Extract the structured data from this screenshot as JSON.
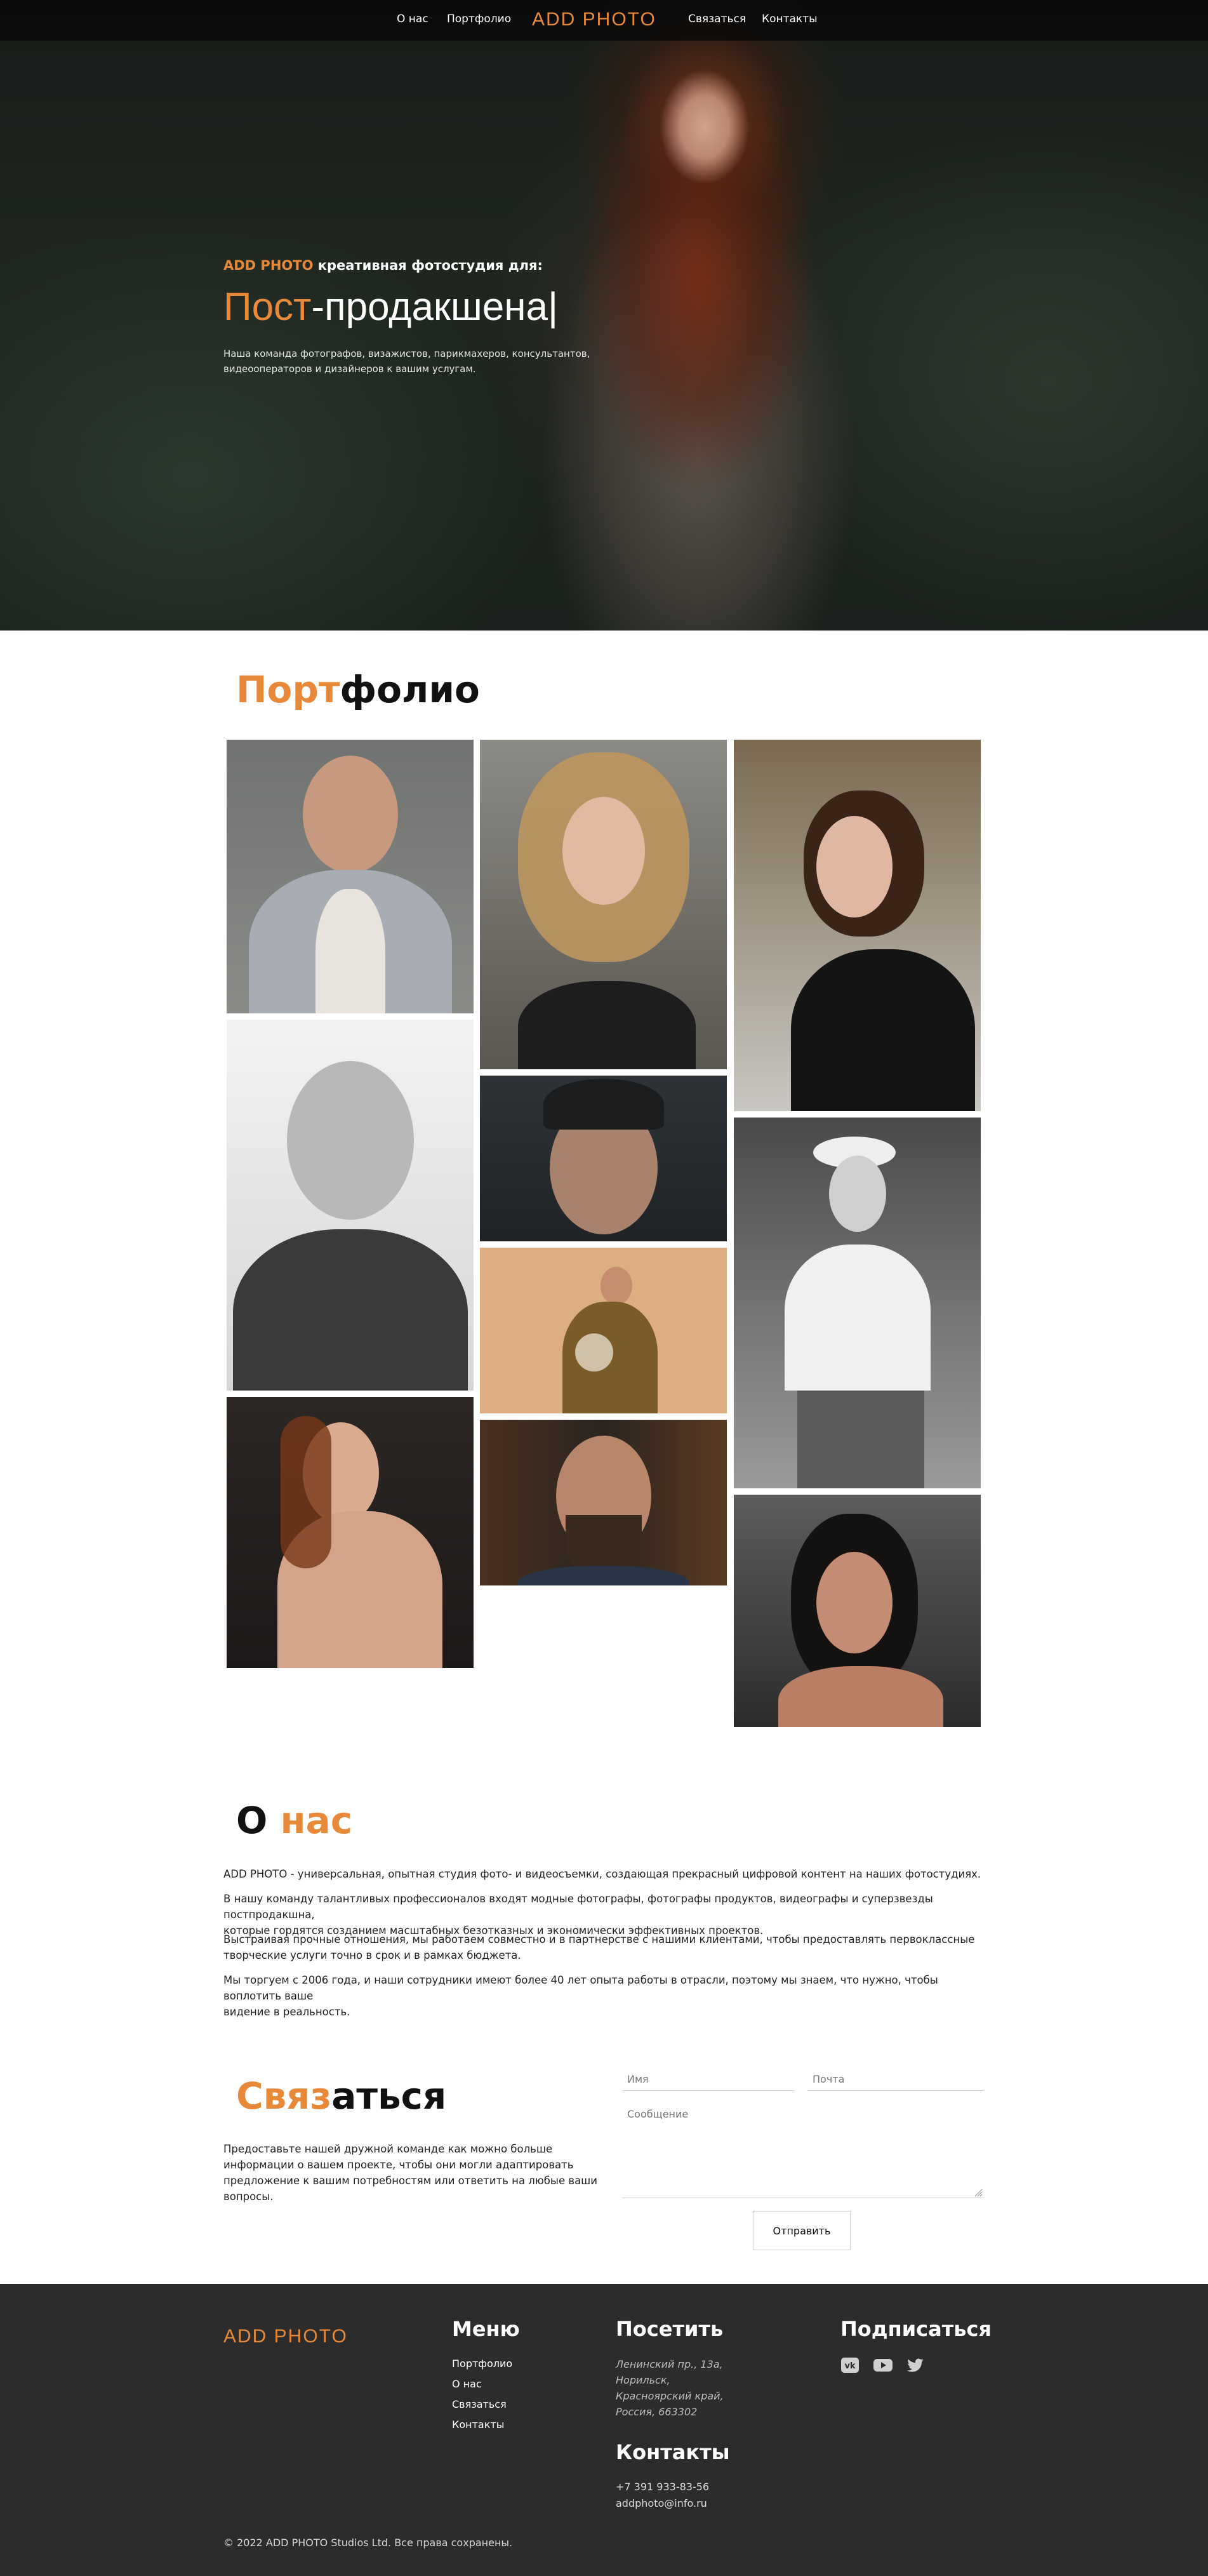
{
  "nav": {
    "about": "О нас",
    "portfolio": "Портфолио",
    "logo": "ADD PHOTO",
    "contact": "Связаться",
    "contacts": "Контакты"
  },
  "hero": {
    "sub_accent": "ADD PHOTO",
    "sub_rest": " креативная фотостудия для:",
    "title_accent": "Пост",
    "title_rest": "-продакшена|",
    "desc_line1": "Наша команда фотографов, визажистов, парикмахеров, консультантов,",
    "desc_line2": "видеооператоров и дизайнеров к вашим услугам."
  },
  "portfolio": {
    "title_accent": "Порт",
    "title_rest": "фолио"
  },
  "about": {
    "title_first": "О ",
    "title_accent": "нас",
    "p1": "ADD PHOTO - универсальная, опытная студия фото- и видеосъемки, создающая прекрасный цифровой контент на наших фотостудиях.",
    "p2_line1": "В нашу команду талантливых профессионалов входят модные фотографы, фотографы продуктов, видеографы и суперзвезды постпродакшна,",
    "p2_line2": "которые гордятся созданием масштабных безотказных и экономически эффективных проектов.",
    "p3_line1": "Выстраивая прочные отношения, мы работаем совместно и в партнерстве с нашими клиентами, чтобы предоставлять первоклассные",
    "p3_line2": "творческие услуги точно в срок и в рамках бюджета.",
    "p4_line1": "Мы торгуем с 2006 года, и наши сотрудники имеют более 40 лет опыта работы в отрасли, поэтому мы знаем, что нужно, чтобы воплотить ваше",
    "p4_line2": "видение в реальность."
  },
  "contact": {
    "title_accent": "Связ",
    "title_rest": "аться",
    "desc_line1": "Предоставьте нашей дружной команде как можно больше",
    "desc_line2": "информации о вашем проекте, чтобы они могли адаптировать",
    "desc_line3": "предложение к вашим потребностям или ответить на любые ваши",
    "desc_line4": "вопросы.",
    "name_placeholder": "Имя",
    "email_placeholder": "Почта",
    "message_placeholder": "Сообщение",
    "send": "Отправить"
  },
  "footer": {
    "logo": "ADD PHOTO",
    "menu_title": "Меню",
    "menu": [
      "Портфолио",
      "О нас",
      "Связаться",
      "Контакты"
    ],
    "visit_title": "Посетить",
    "address": [
      "Ленинский пр., 13а,",
      "Норильск,",
      "Красноярский край,",
      "Россия, 663302"
    ],
    "contacts_title": "Контакты",
    "phone": "+7 391 933-83-56",
    "email": "addphoto@info.ru",
    "subscribe_title": "Подписаться",
    "copyright": "© 2022 ADD PHOTO Studios Ltd. Все права сохранены."
  },
  "colors": {
    "accent": "#e88939",
    "footer_bg": "#2c2c2c"
  },
  "icons": [
    "vk-icon",
    "youtube-icon",
    "twitter-icon"
  ]
}
